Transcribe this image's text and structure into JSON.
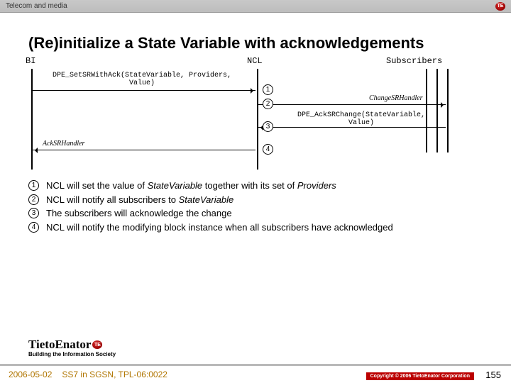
{
  "topbar": {
    "category": "Telecom and media",
    "logo": "TE"
  },
  "title": "(Re)initialize a State Variable with acknowledgements",
  "diagram": {
    "actors": {
      "bi": "BI",
      "ncl": "NCL",
      "subs": "Subscribers"
    },
    "msg1": "DPE_SetSRWithAck(StateVariable, Providers,\nValue)",
    "msg2": "ChangeSRHandler",
    "msg3": "DPE_AckSRChange(StateVariable,\nValue)",
    "msg4": "AckSRHandler",
    "steps": {
      "s1": "1",
      "s2": "2",
      "s3": "3",
      "s4": "4"
    }
  },
  "notes": {
    "n1": "NCL will set the value of StateVariable together with its set of Providers",
    "n2": "NCL will notify all subscribers to StateVariable",
    "n3": "The subscribers will acknowledge the change",
    "n4": "NCL will notify the modifying block instance when all subscribers have acknowledged"
  },
  "brand": {
    "name": "TietoEnator",
    "tagline": "Building the Information Society"
  },
  "footer": {
    "date": "2006-05-02",
    "doc": "SS7 in SGSN, TPL-06:0022",
    "copyright": "Copyright © 2006 TietoEnator Corporation",
    "page": "155"
  }
}
